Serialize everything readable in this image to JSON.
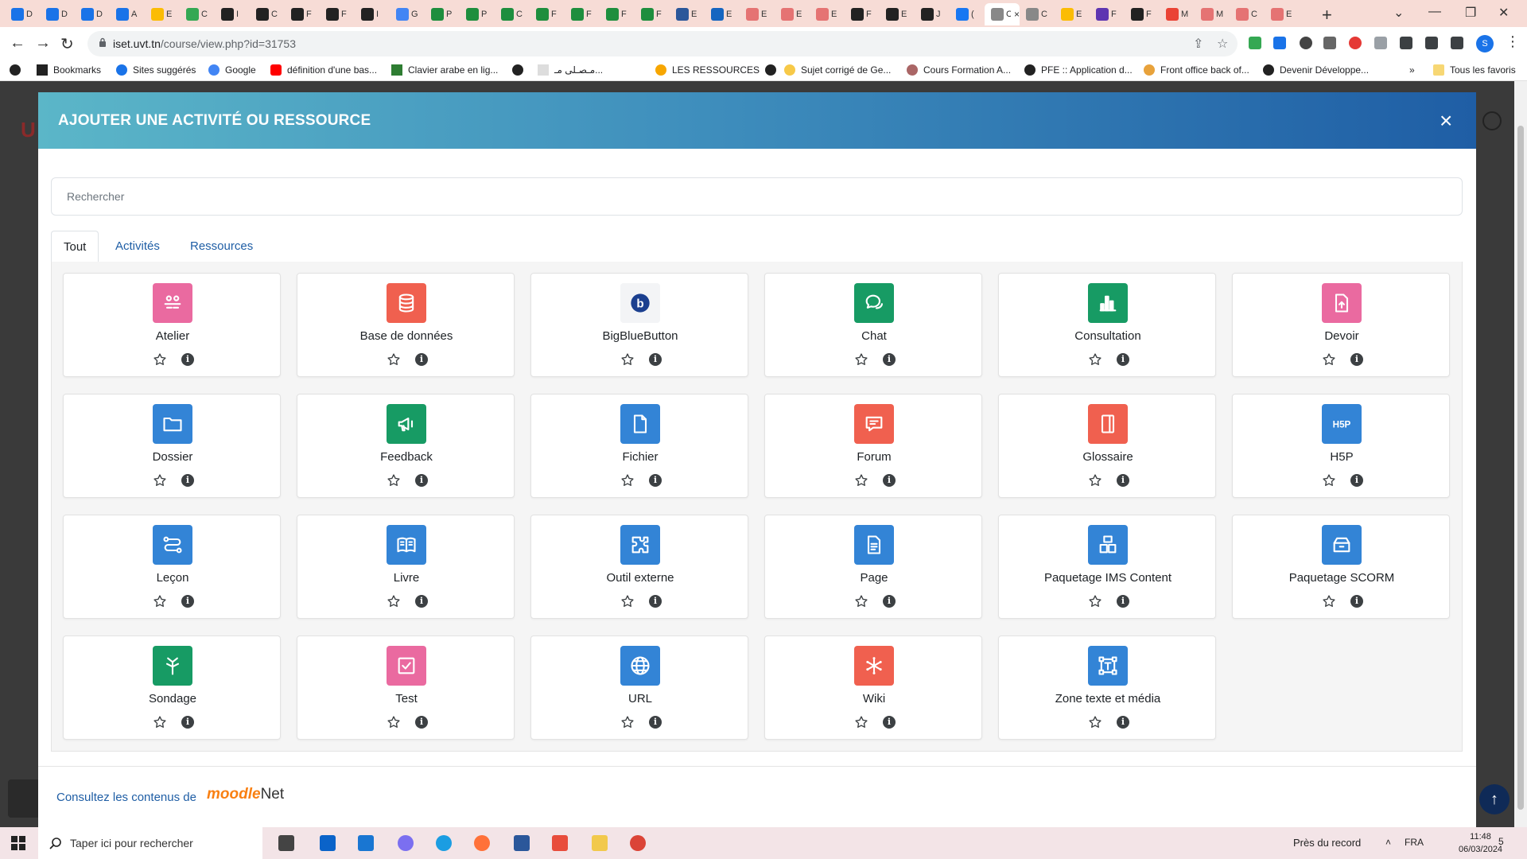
{
  "browser": {
    "tab_titles": [
      "D",
      "D",
      "D",
      "A",
      "E",
      "C",
      "I",
      "C",
      "F",
      "F",
      "I",
      "G",
      "P",
      "P",
      "C",
      "F",
      "F",
      "F",
      "F",
      "E",
      "E",
      "E",
      "E",
      "E",
      "F",
      "E",
      "J",
      "(",
      "C",
      "C",
      "E",
      "F",
      "F",
      "M",
      "M",
      "C",
      "E"
    ],
    "active_tab_index": 28,
    "tab_close": "×",
    "new_tab": "+",
    "url_host": "iset.uvt.tn",
    "url_path": "/course/view.php?id=31753",
    "profile_initial": "S",
    "bookmarks": [
      "Bookmarks",
      "Sites suggérés",
      "Google",
      "définition d'une bas...",
      "Clavier arabe en lig...",
      "مـصـلى مـ...",
      "LES RESSOURCES",
      "Sujet corrigé de Ge...",
      "Cours Formation A...",
      "PFE :: Application d...",
      "Front office back of...",
      "Devenir Développe..."
    ],
    "bookmarks_more": "»",
    "all_bookmarks": "Tous les favoris"
  },
  "modal": {
    "title": "AJOUTER UNE ACTIVITÉ OU RESSOURCE",
    "close": "×",
    "search_placeholder": "Rechercher",
    "tabs": [
      "Tout",
      "Activités",
      "Ressources"
    ],
    "active_tab": "Tout",
    "items": [
      {
        "name": "Atelier",
        "icon": "workshop-icon",
        "color": "#ea6aa0"
      },
      {
        "name": "Base de données",
        "icon": "database-icon",
        "color": "#f0604f"
      },
      {
        "name": "BigBlueButton",
        "icon": "bigbluebutton-icon",
        "color": "#f3f4f6"
      },
      {
        "name": "Chat",
        "icon": "chat-icon",
        "color": "#179b64"
      },
      {
        "name": "Consultation",
        "icon": "bar-chart-icon",
        "color": "#179b64"
      },
      {
        "name": "Devoir",
        "icon": "assignment-icon",
        "color": "#ea6aa0"
      },
      {
        "name": "Dossier",
        "icon": "folder-icon",
        "color": "#3384d6"
      },
      {
        "name": "Feedback",
        "icon": "megaphone-icon",
        "color": "#179b64"
      },
      {
        "name": "Fichier",
        "icon": "file-icon",
        "color": "#3384d6"
      },
      {
        "name": "Forum",
        "icon": "forum-icon",
        "color": "#f0604f"
      },
      {
        "name": "Glossaire",
        "icon": "glossary-icon",
        "color": "#f0604f"
      },
      {
        "name": "H5P",
        "icon": "h5p-icon",
        "color": "#3384d6"
      },
      {
        "name": "Leçon",
        "icon": "lesson-icon",
        "color": "#3384d6"
      },
      {
        "name": "Livre",
        "icon": "book-icon",
        "color": "#3384d6"
      },
      {
        "name": "Outil externe",
        "icon": "puzzle-icon",
        "color": "#3384d6"
      },
      {
        "name": "Page",
        "icon": "page-icon",
        "color": "#3384d6"
      },
      {
        "name": "Paquetage IMS Content",
        "icon": "ims-package-icon",
        "color": "#3384d6"
      },
      {
        "name": "Paquetage SCORM",
        "icon": "scorm-package-icon",
        "color": "#3384d6"
      },
      {
        "name": "Sondage",
        "icon": "signpost-icon",
        "color": "#179b64"
      },
      {
        "name": "Test",
        "icon": "checkbox-icon",
        "color": "#ea6aa0"
      },
      {
        "name": "URL",
        "icon": "globe-icon",
        "color": "#3384d6"
      },
      {
        "name": "Wiki",
        "icon": "wiki-icon",
        "color": "#f0604f"
      },
      {
        "name": "Zone texte et média",
        "icon": "text-media-icon",
        "color": "#3384d6"
      }
    ],
    "footer_text": "Consultez les contenus de",
    "footer_brand_moodle": "moodle",
    "footer_brand_net": "Net"
  },
  "taskbar": {
    "search_text": "Taper ici pour rechercher",
    "weather": "Près du record",
    "language": "FRA",
    "time": "11:48",
    "date": "06/03/2024",
    "notifications": "5"
  }
}
